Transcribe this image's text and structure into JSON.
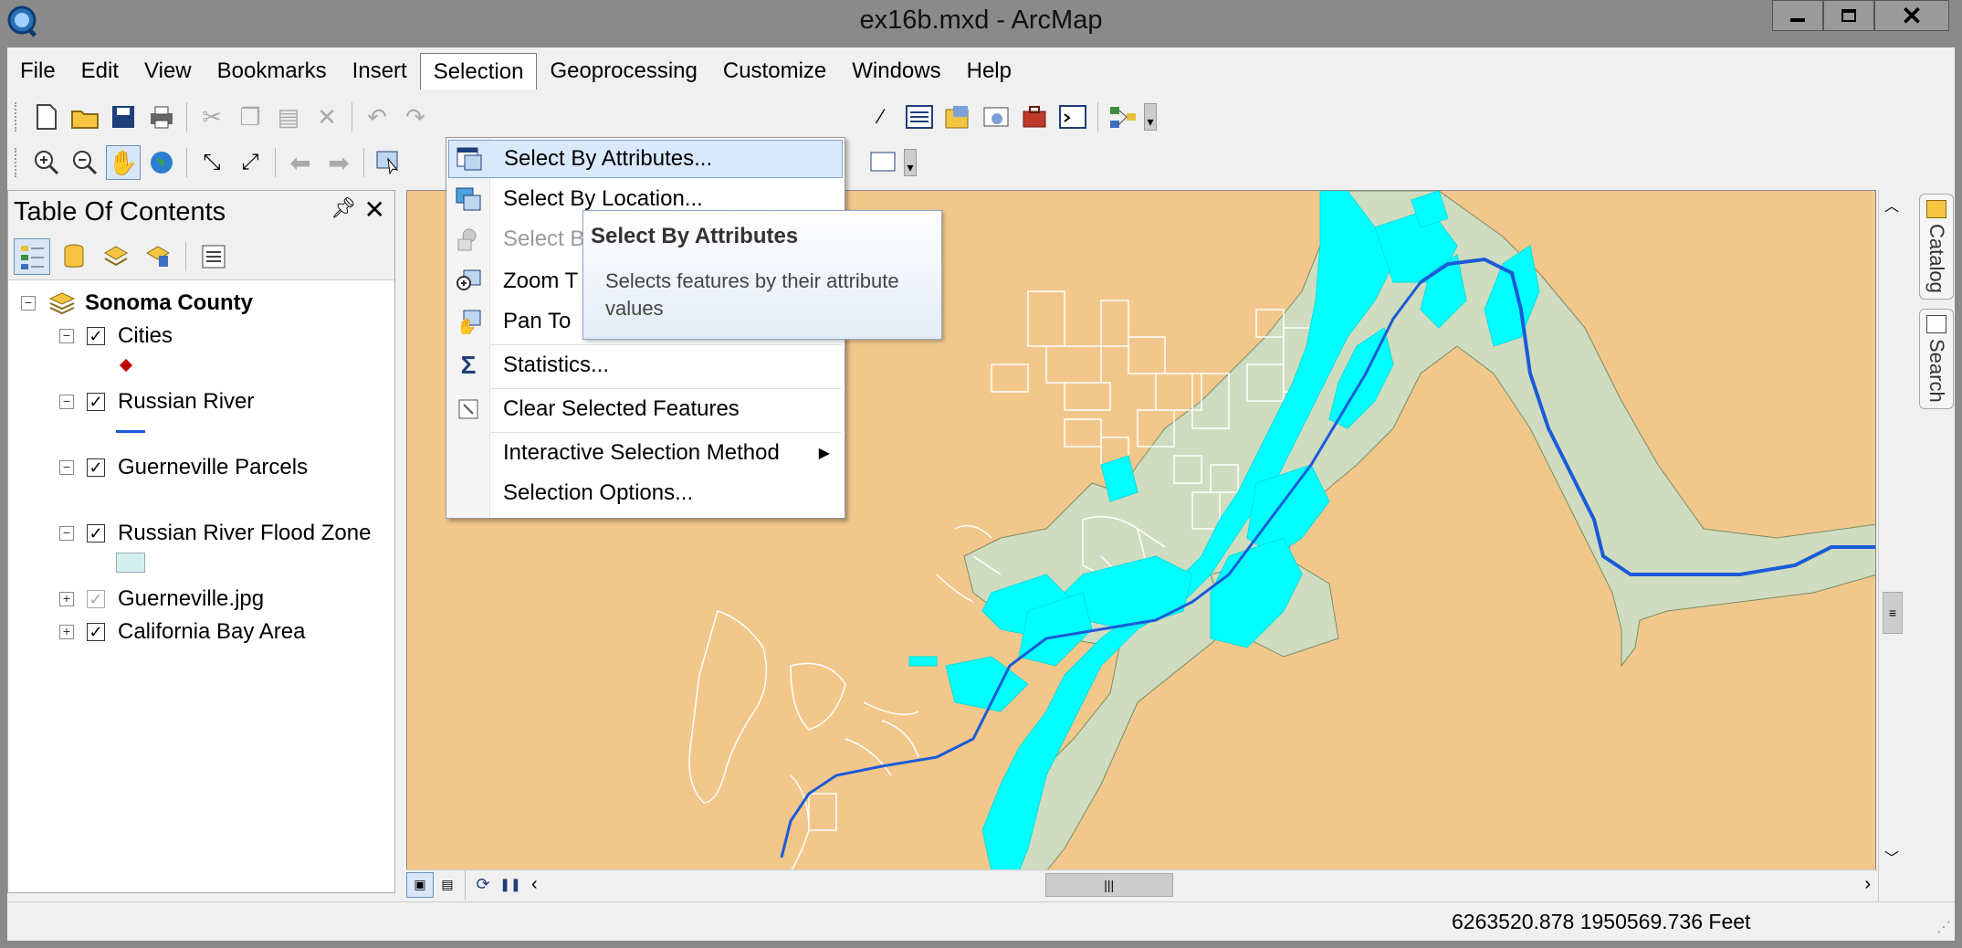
{
  "window": {
    "title": "ex16b.mxd - ArcMap",
    "minimize_icon": "minimize-icon",
    "maximize_icon": "maximize-icon",
    "close_icon": "close-icon"
  },
  "menubar": {
    "items": [
      "File",
      "Edit",
      "View",
      "Bookmarks",
      "Insert",
      "Selection",
      "Geoprocessing",
      "Customize",
      "Windows",
      "Help"
    ],
    "active": "Selection"
  },
  "selection_menu": {
    "items": [
      {
        "label": "Select By Attributes...",
        "icon": "select-by-attributes-icon",
        "highlighted": true
      },
      {
        "label": "Select By Location...",
        "icon": "select-by-location-icon"
      },
      {
        "label": "Select B",
        "icon": "select-by-graphics-icon",
        "disabled": true
      },
      {
        "label": "Zoom T",
        "icon": "zoom-to-selected-icon"
      },
      {
        "label": "Pan To",
        "icon": "pan-to-selected-icon"
      },
      {
        "label": "Statistics...",
        "icon": "sigma-icon"
      },
      {
        "label": "Clear Selected Features",
        "icon": "clear-selection-icon"
      },
      {
        "label": "Interactive Selection Method",
        "icon": "",
        "submenu": true
      },
      {
        "label": "Selection Options...",
        "icon": ""
      }
    ]
  },
  "tooltip": {
    "title": "Select By Attributes",
    "body": "Selects features by their attribute values"
  },
  "toc": {
    "title": "Table Of Contents",
    "root": "Sonoma County",
    "layers": [
      {
        "name": "Cities",
        "checked": true,
        "symbol": "red-point"
      },
      {
        "name": "Russian River",
        "checked": true,
        "symbol": "blue-line"
      },
      {
        "name": "Guerneville Parcels",
        "checked": true,
        "symbol": "none"
      },
      {
        "name": "Russian River Flood Zone",
        "checked": true,
        "symbol": "light-cyan-fill"
      },
      {
        "name": "Guerneville.jpg",
        "checked": true,
        "collapsed": true
      },
      {
        "name": "California Bay Area",
        "checked": true,
        "collapsed": true
      }
    ]
  },
  "sidetabs": [
    "Catalog",
    "Search"
  ],
  "status": {
    "coordinates": "6263520.878  1950569.736 Feet"
  },
  "colors": {
    "map_background": "#f2c78b",
    "flood_zone": "#cfdcbf",
    "selected_parcels": "#00ffff",
    "river": "#1a5bd8",
    "menu_highlight": "#d9e8fb"
  }
}
